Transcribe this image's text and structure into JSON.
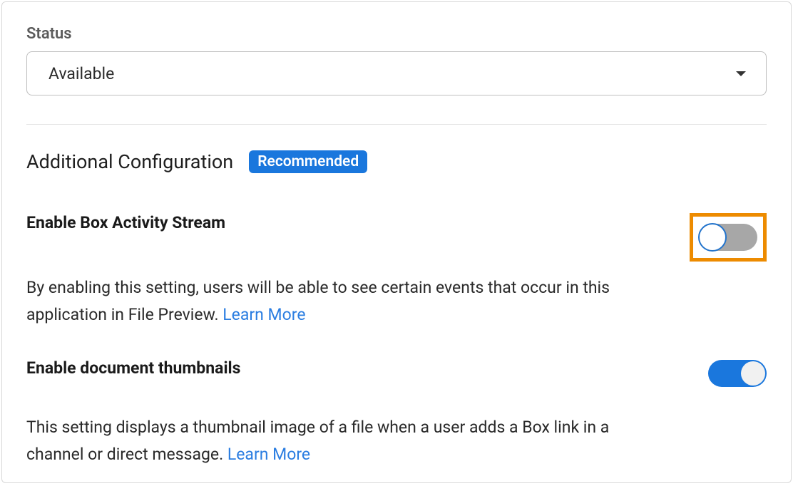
{
  "status": {
    "label": "Status",
    "selected": "Available"
  },
  "section": {
    "title": "Additional Configuration",
    "badge": "Recommended"
  },
  "settings": {
    "activity_stream": {
      "title": "Enable Box Activity Stream",
      "desc_pre": "By enabling this setting, users will be able to see certain events that occur in this application in File Preview. ",
      "learn_more": "Learn More",
      "enabled": false,
      "highlighted": true
    },
    "doc_thumbnails": {
      "title": "Enable document thumbnails",
      "desc_pre": "This setting displays a thumbnail image of a file when a user adds a Box link in a channel or direct message. ",
      "learn_more": "Learn More",
      "enabled": true
    }
  }
}
